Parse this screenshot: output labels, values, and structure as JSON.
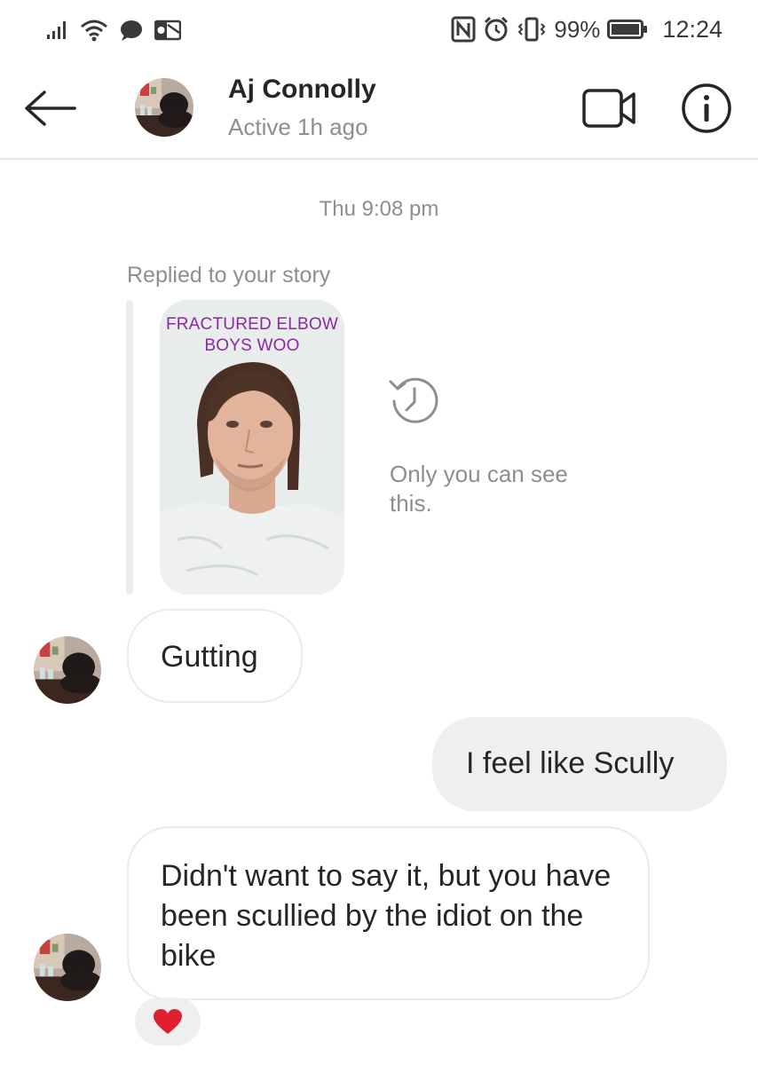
{
  "status_bar": {
    "battery": "99%",
    "time": "12:24",
    "icons": [
      "signal-icon",
      "wifi-icon",
      "chat-bubble-icon",
      "outlook-icon",
      "nfc-icon",
      "alarm-icon",
      "vibrate-icon",
      "battery-icon"
    ]
  },
  "header": {
    "back_icon": "back-arrow-icon",
    "contact_name": "Aj Connolly",
    "contact_status": "Active 1h ago",
    "video_icon": "video-call-icon",
    "info_icon": "info-icon"
  },
  "thread": {
    "timestamp": "Thu 9:08 pm",
    "story_reply": {
      "label": "Replied to your story",
      "caption_line1": "FRACTURED ELBOW",
      "caption_line2": "BOYS WOO",
      "private_note": "Only you can see this."
    },
    "messages": [
      {
        "from": "contact",
        "text": "Gutting"
      },
      {
        "from": "me",
        "text": "I feel like Scully"
      },
      {
        "from": "contact",
        "text": "Didn't want to say it, but you have been scullied by the idiot on the bike",
        "reaction": "❤"
      }
    ]
  },
  "colors": {
    "accent_reaction": "#e0202e",
    "bubble_outgoing": "#efefef",
    "secondary_text": "#8e8e8e",
    "story_caption": "#8a2aa0"
  }
}
